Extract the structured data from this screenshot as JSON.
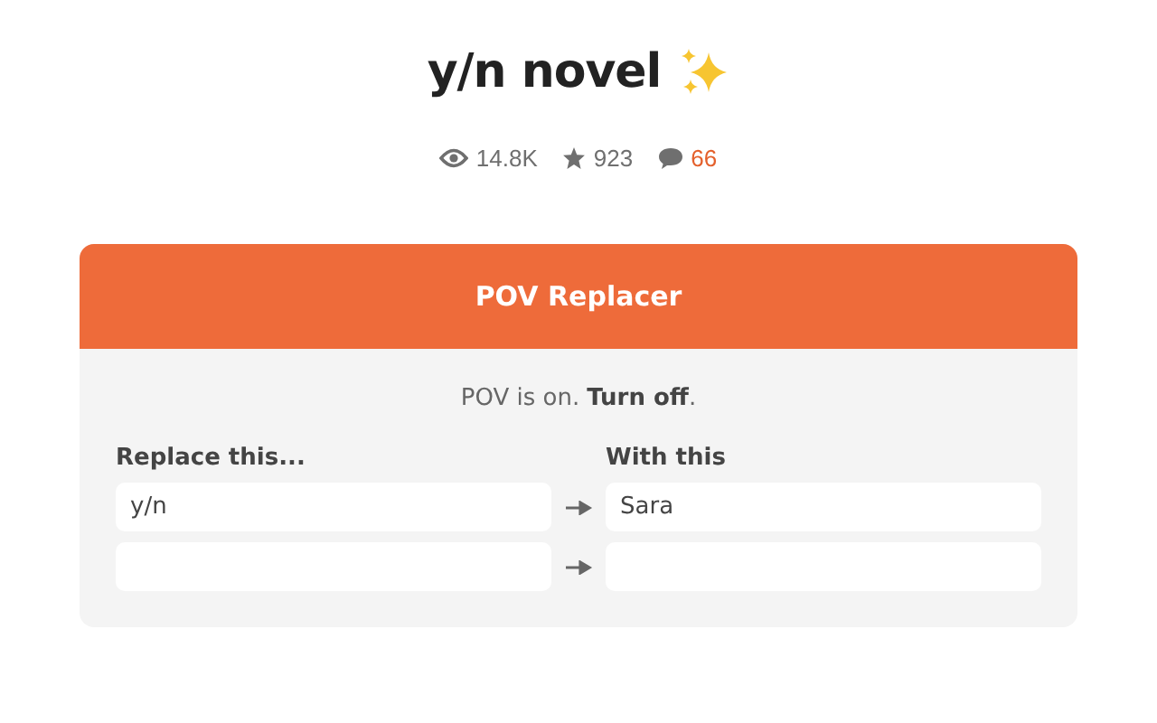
{
  "title": "y/n novel",
  "stats": [
    {
      "kind": "views",
      "value": "14.8K"
    },
    {
      "kind": "stars",
      "value": "923"
    },
    {
      "kind": "comments",
      "value": "66"
    }
  ],
  "pov_replacer": {
    "title": "POV Replacer",
    "status_text": "POV is on.",
    "toggle_link": "Turn off",
    "status_end": ".",
    "columns": [
      "Replace this...",
      "With this"
    ],
    "rows": [
      {
        "replace": "y/n",
        "with": "Sara"
      },
      {}
    ]
  }
}
